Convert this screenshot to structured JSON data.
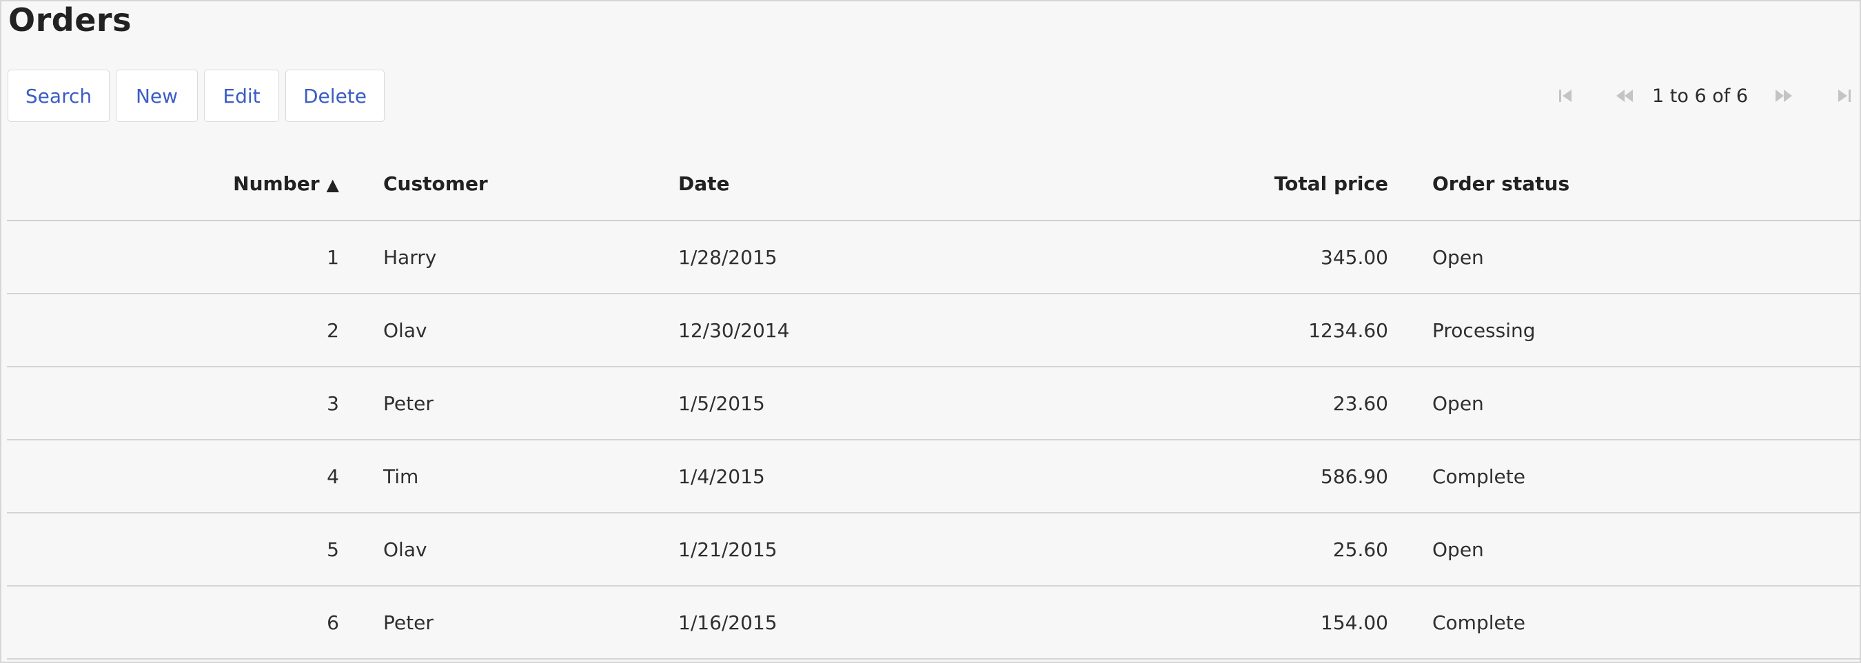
{
  "page": {
    "title": "Orders"
  },
  "toolbar": {
    "search_label": "Search",
    "new_label": "New",
    "edit_label": "Edit",
    "delete_label": "Delete"
  },
  "pager": {
    "status": "1 to 6 of 6",
    "icons": [
      "first-page-icon",
      "previous-page-icon",
      "next-page-icon",
      "last-page-icon"
    ]
  },
  "table": {
    "headers": {
      "number": "Number",
      "number_sort": "▲",
      "customer": "Customer",
      "date": "Date",
      "total_price": "Total price",
      "order_status": "Order status"
    },
    "rows": [
      {
        "number": "1",
        "customer": "Harry",
        "date": "1/28/2015",
        "total_price": "345.00",
        "order_status": "Open"
      },
      {
        "number": "2",
        "customer": "Olav",
        "date": "12/30/2014",
        "total_price": "1234.60",
        "order_status": "Processing"
      },
      {
        "number": "3",
        "customer": "Peter",
        "date": "1/5/2015",
        "total_price": "23.60",
        "order_status": "Open"
      },
      {
        "number": "4",
        "customer": "Tim",
        "date": "1/4/2015",
        "total_price": "586.90",
        "order_status": "Complete"
      },
      {
        "number": "5",
        "customer": "Olav",
        "date": "1/21/2015",
        "total_price": "25.60",
        "order_status": "Open"
      },
      {
        "number": "6",
        "customer": "Peter",
        "date": "1/16/2015",
        "total_price": "154.00",
        "order_status": "Complete"
      }
    ]
  },
  "colors": {
    "background": "#f7f7f7",
    "button_text": "#3b5cc4",
    "pager_icon_disabled": "#c4c4c4"
  }
}
